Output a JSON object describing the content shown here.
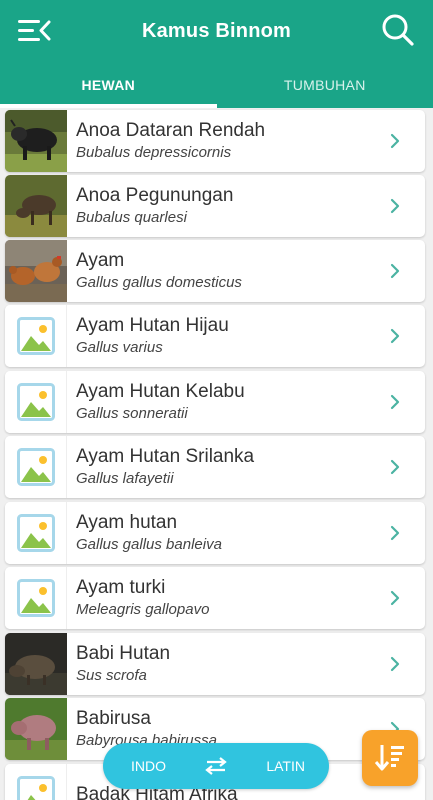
{
  "app": {
    "title": "Kamus Binnom"
  },
  "tabs": [
    {
      "label": "HEWAN",
      "active": true
    },
    {
      "label": "TUMBUHAN",
      "active": false
    }
  ],
  "items": [
    {
      "name": "Anoa Dataran Rendah",
      "latin": "Bubalus depressicornis",
      "thumb": "photo"
    },
    {
      "name": "Anoa Pegunungan",
      "latin": "Bubalus quarlesi",
      "thumb": "photo"
    },
    {
      "name": "Ayam",
      "latin": "Gallus gallus domesticus",
      "thumb": "photo"
    },
    {
      "name": "Ayam Hutan Hijau",
      "latin": "Gallus varius",
      "thumb": "placeholder"
    },
    {
      "name": "Ayam Hutan Kelabu",
      "latin": "Gallus sonneratii",
      "thumb": "placeholder"
    },
    {
      "name": "Ayam Hutan Srilanka",
      "latin": "Gallus lafayetii",
      "thumb": "placeholder"
    },
    {
      "name": "Ayam hutan",
      "latin": "Gallus gallus banleiva",
      "thumb": "placeholder"
    },
    {
      "name": "Ayam turki",
      "latin": "Meleagris gallopavo",
      "thumb": "placeholder"
    },
    {
      "name": "Babi Hutan",
      "latin": "Sus scrofa",
      "thumb": "photo"
    },
    {
      "name": "Babirusa",
      "latin": "Babyrousa babirussa",
      "thumb": "photo"
    },
    {
      "name": "Badak Hitam Afrika",
      "latin": "",
      "thumb": "placeholder"
    }
  ],
  "language_toggle": {
    "left": "INDO",
    "right": "LATIN"
  },
  "colors": {
    "primary": "#1aa588",
    "toggle": "#30c4df",
    "fab": "#f8a22a",
    "chevron": "#4bb3a2"
  },
  "icons": {
    "menu": "menu-collapse-icon",
    "search": "search-icon",
    "swap": "swap-arrows-icon",
    "sort": "sort-descending-icon",
    "chevron": "chevron-right-icon",
    "placeholder": "image-placeholder-icon"
  }
}
